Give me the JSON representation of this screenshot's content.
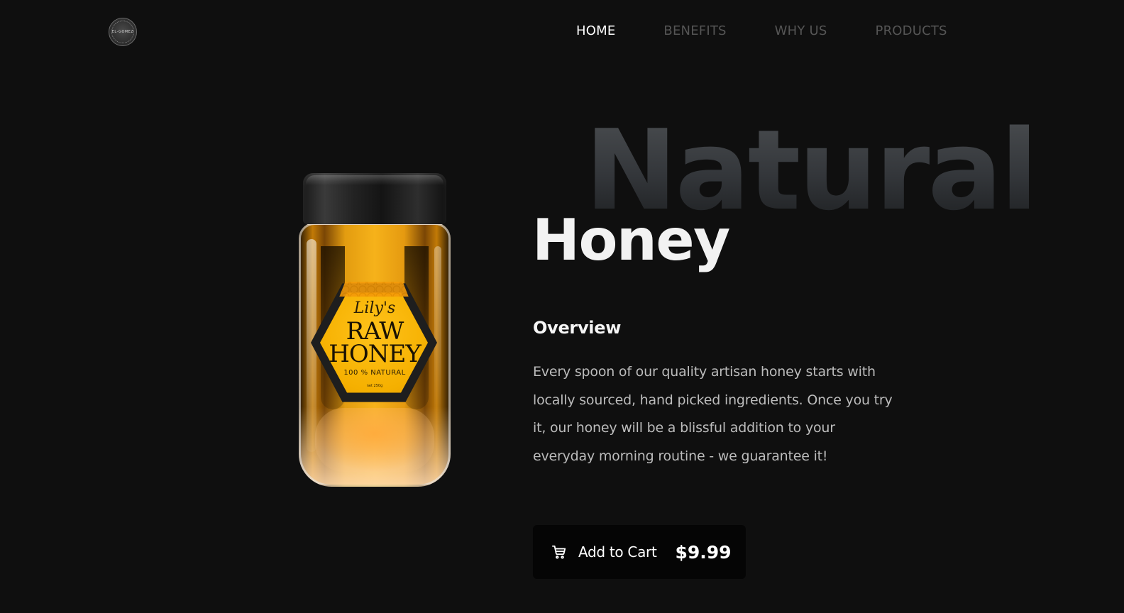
{
  "brand": {
    "logo_text": "EL-GOMEZ"
  },
  "nav": {
    "items": [
      {
        "label": "HOME",
        "active": true
      },
      {
        "label": "BENEFITS",
        "active": false
      },
      {
        "label": "WHY US",
        "active": false
      },
      {
        "label": "PRODUCTS",
        "active": false
      }
    ]
  },
  "product": {
    "label": {
      "script": "Lily's",
      "line1": "RAW",
      "line2": "HONEY",
      "tagline": "100 % NATURAL",
      "net": "net 250g"
    },
    "headline_background": "Natural",
    "headline": "Honey",
    "overview_title": "Overview",
    "overview_text": "Every spoon of our quality artisan honey starts with locally sourced, hand picked ingredients. Once you try it, our honey will be a blissful addition to your everyday morning routine - we guarantee it!",
    "cart_label": "Add to Cart",
    "price": "$9.99"
  },
  "colors": {
    "background": "#0f0f0f",
    "nav_active": "#ffffff",
    "nav_inactive": "#555555",
    "honey": "#f5b000",
    "button_bg": "#050505"
  },
  "icons": {
    "cart": "shopping-cart-icon",
    "logo": "logo-badge"
  }
}
